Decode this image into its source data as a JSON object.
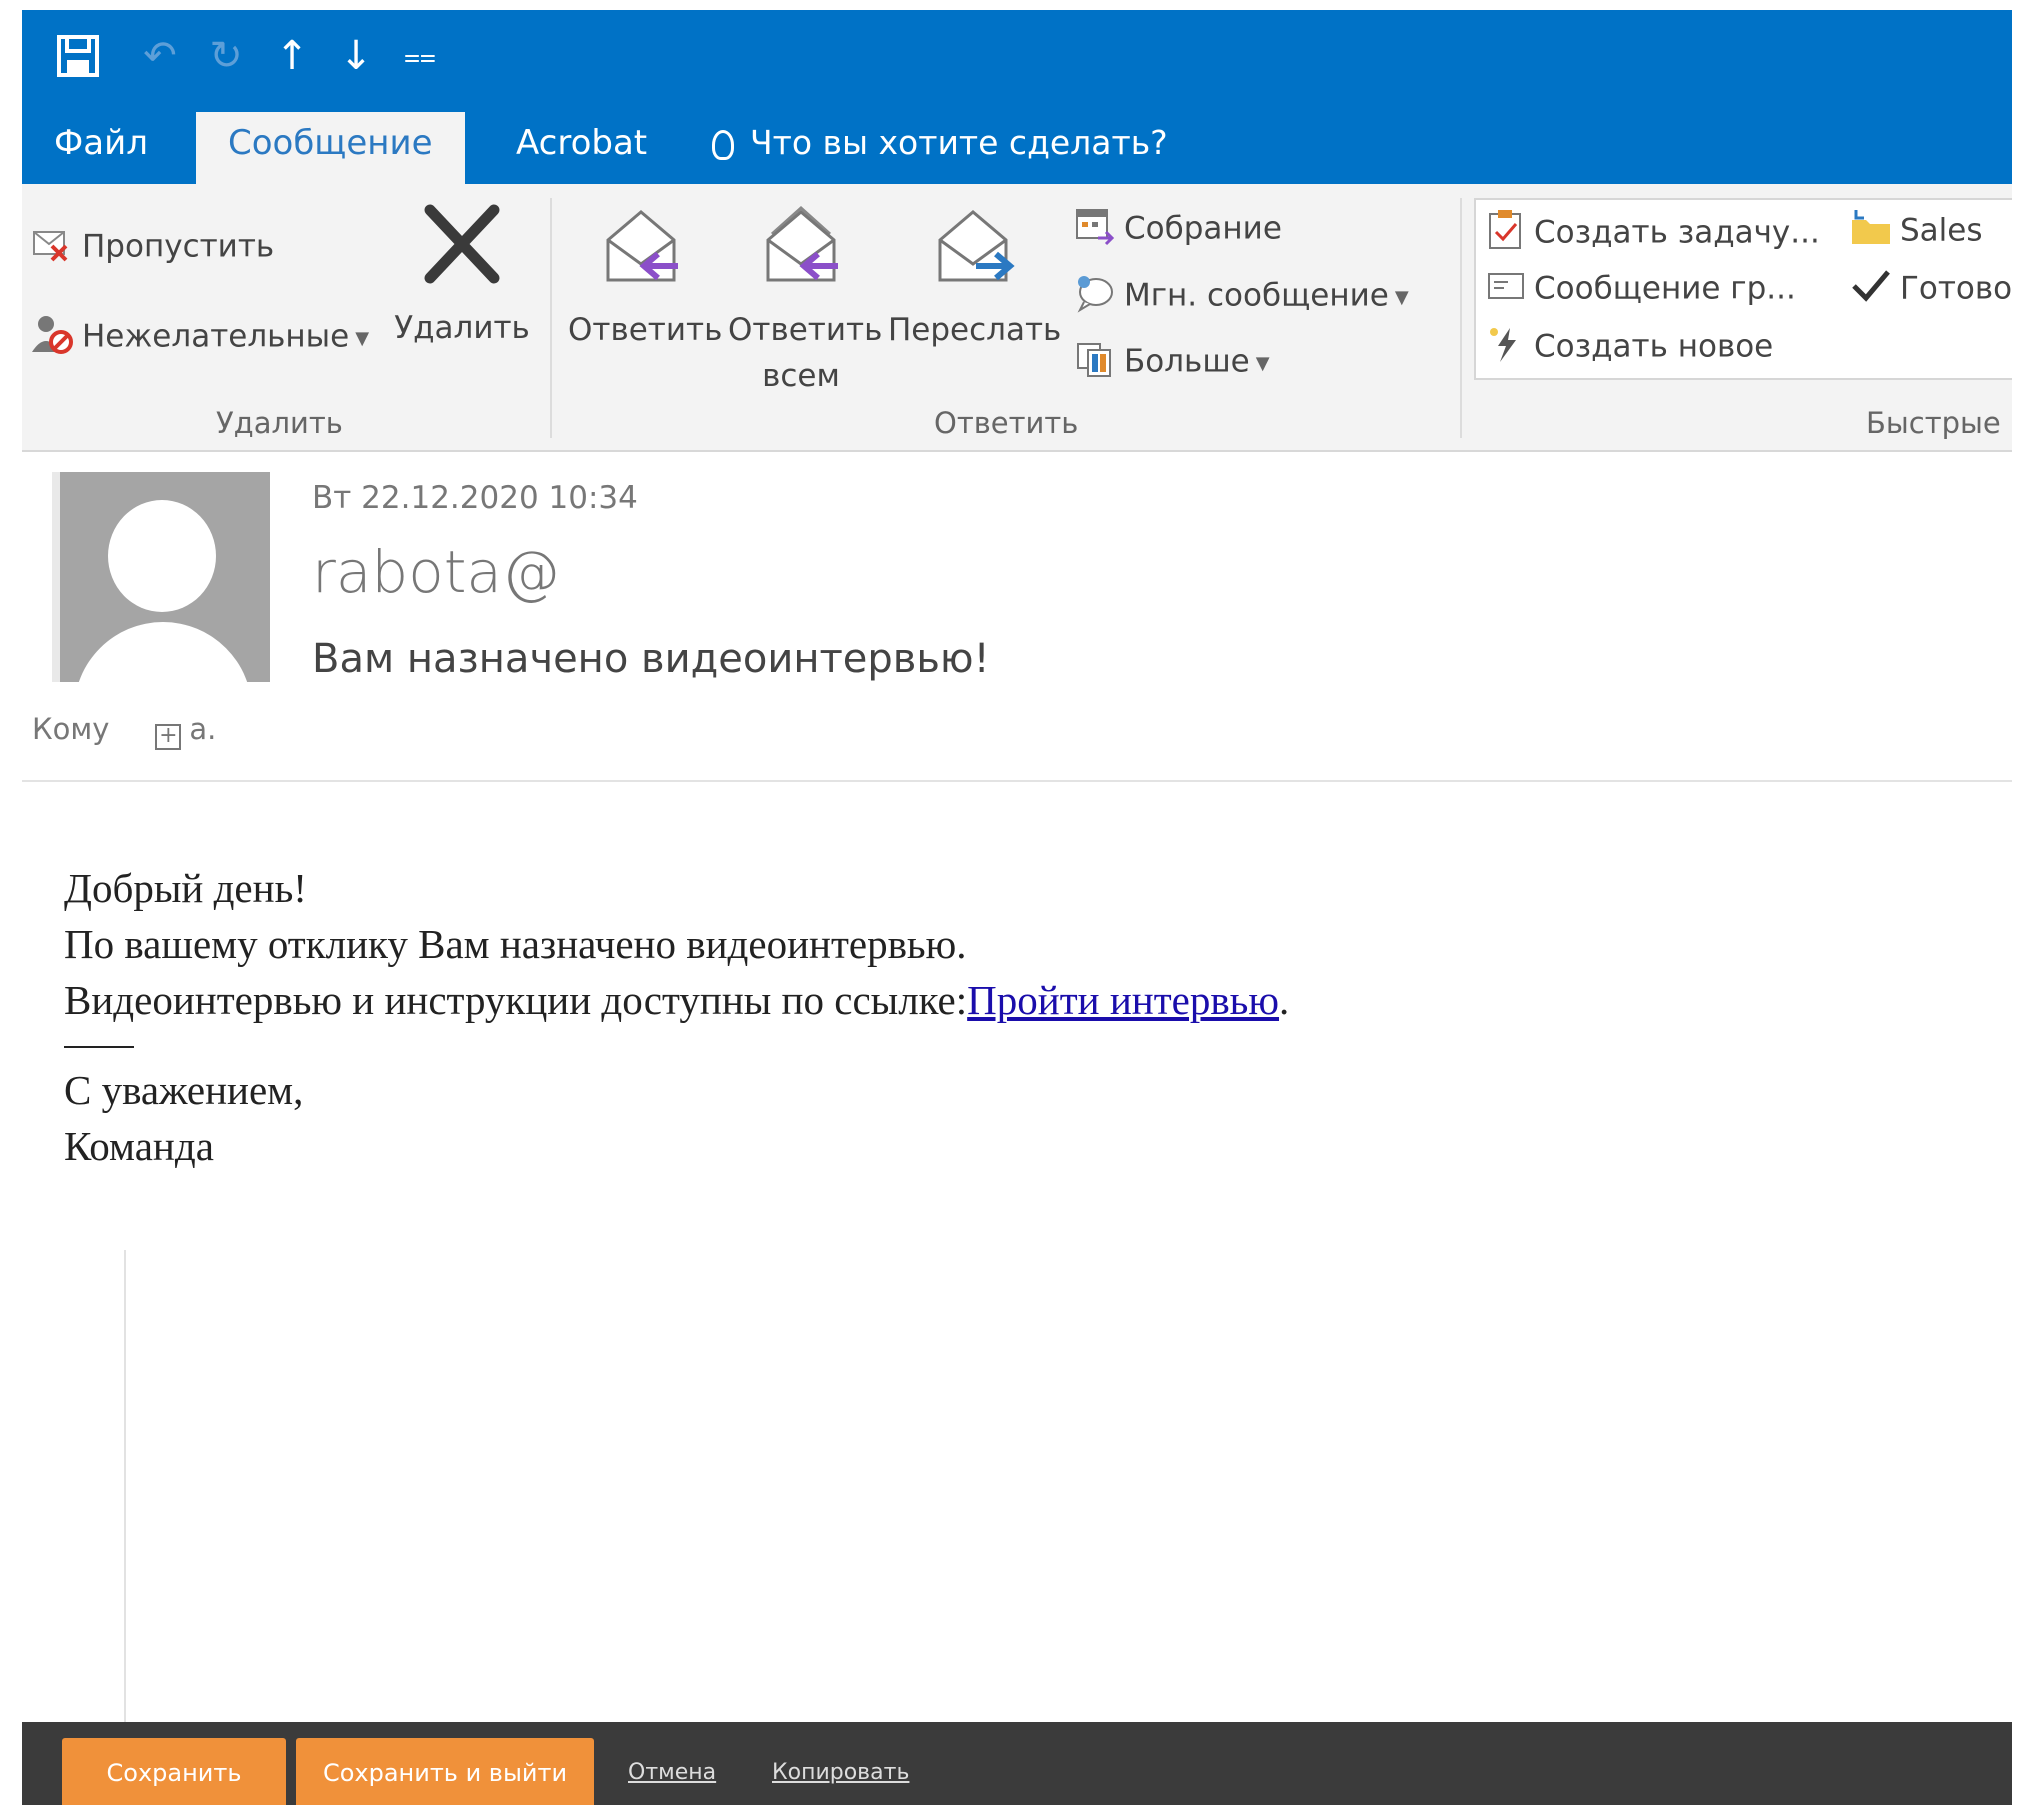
{
  "tabs": {
    "file": "Файл",
    "message": "Сообщение",
    "acrobat": "Acrobat",
    "tell_me": "Что вы хотите сделать?"
  },
  "ribbon": {
    "delete_group": {
      "ignore": "Пропустить",
      "junk": "Нежелательные",
      "delete": "Удалить",
      "label": "Удалить"
    },
    "respond_group": {
      "reply": "Ответить",
      "reply_all_line1": "Ответить",
      "reply_all_line2": "всем",
      "forward": "Переслать",
      "meeting": "Собрание",
      "im": "Мгн. сообщение",
      "more": "Больше",
      "label": "Ответить"
    },
    "quick_steps": {
      "create_task": "Создать задачу...",
      "team_email": "Сообщение гр...",
      "create_new": "Создать новое",
      "sales": "Sales",
      "done": "Готово",
      "label": "Быстрые"
    }
  },
  "header": {
    "date": "Вт 22.12.2020 10:34",
    "from": "rabota@",
    "subject": "Вам назначено видеоинтервью!",
    "to_label": "Кому",
    "to_value": "a."
  },
  "body": {
    "line1": "Добрый день!",
    "line2": "По вашему отклику Вам назначено видеоинтервью.",
    "line3_prefix": "Видеоинтервью и инструкции доступны по ссылке:",
    "link_text": "Пройти интервью",
    "line3_suffix": ".",
    "closing": "С уважением,",
    "team": "Команда"
  },
  "bottom_bar": {
    "save": "Сохранить",
    "save_exit": "Сохранить и выйти",
    "cancel": "Отмена",
    "copy": "Копировать"
  },
  "colors": {
    "titlebar": "#0072c6",
    "ribbon": "#f3f3f3",
    "orange_button": "#f0913a",
    "bottom_bar": "#3b3b3b",
    "link": "#1a0dab"
  }
}
